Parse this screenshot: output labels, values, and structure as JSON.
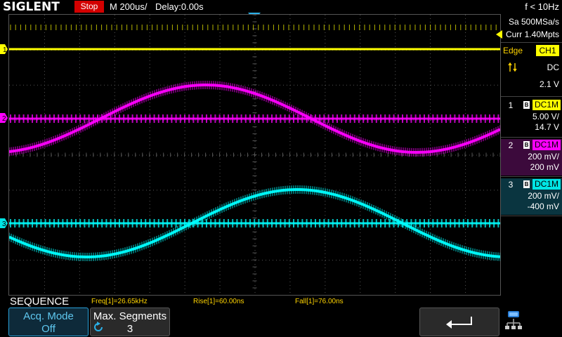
{
  "brand": "SIGLENT",
  "status": {
    "label": "Stop",
    "color": "#d40000"
  },
  "timebase": {
    "label": "M 200us/"
  },
  "delay": {
    "label": "Delay:0.00s"
  },
  "freq_counter": "f < 10Hz",
  "acquisition": {
    "sample_rate": "Sa 500MSa/s",
    "memory": "Curr 1.40Mpts"
  },
  "trigger": {
    "type_label": "Edge",
    "source": "CH1",
    "coupling": "DC",
    "level": "2.1 V",
    "slope_icon": "slope-both-icon"
  },
  "channels": [
    {
      "num": "1",
      "coupling": "DC1M",
      "scale": "5.00 V/",
      "offset": "14.7 V",
      "color": "#ffff00"
    },
    {
      "num": "2",
      "coupling": "DC1M",
      "scale": "200 mV/",
      "offset": "200 mV",
      "color": "#ff00ff"
    },
    {
      "num": "3",
      "coupling": "DC1M",
      "scale": "200 mV/",
      "offset": "-400 mV",
      "color": "#00ffff"
    }
  ],
  "trace_markers": [
    "1",
    "2",
    "3"
  ],
  "mode_label": "SEQUENCE",
  "measurements": [
    {
      "label": "Freq[1]=26.65kHz"
    },
    {
      "label": "Rise[1]=60.00ns"
    },
    {
      "label": "Fall[1]=76.00ns"
    }
  ],
  "softkeys": {
    "acq_mode": {
      "title": "Acq. Mode",
      "value": "Off"
    },
    "max_segments": {
      "title": "Max. Segments",
      "value": "3"
    },
    "back_icon": "return-arrow-icon"
  },
  "icons": {
    "trigger_position": "trigger-position-marker-icon",
    "network": "network-icon"
  }
}
